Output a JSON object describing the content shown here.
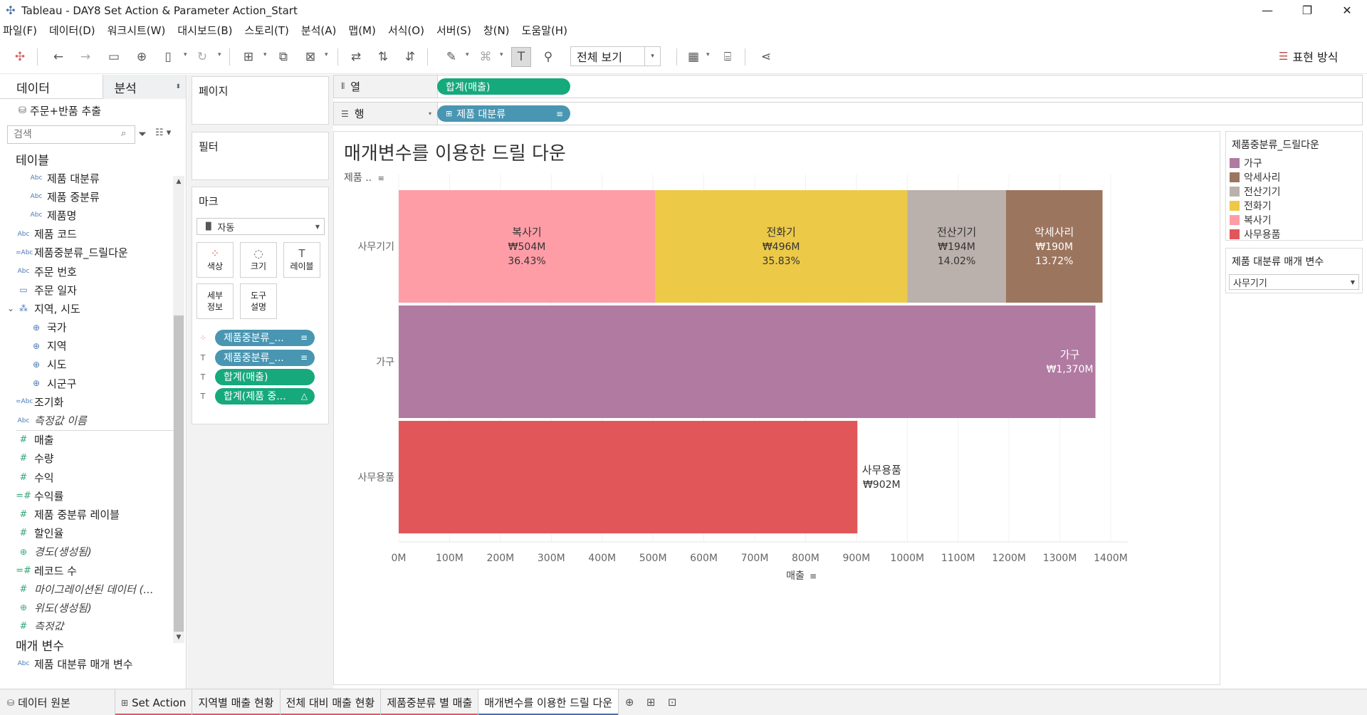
{
  "window": {
    "title": "Tableau - DAY8 Set Action & Parameter Action_Start"
  },
  "menu": [
    "파일(F)",
    "데이터(D)",
    "워크시트(W)",
    "대시보드(B)",
    "스토리(T)",
    "분석(A)",
    "맵(M)",
    "서식(O)",
    "서버(S)",
    "창(N)",
    "도움말(H)"
  ],
  "toolbar": {
    "view_mode": "전체 보기",
    "show_me": "표현 방식"
  },
  "data_pane": {
    "tab_data": "데이터",
    "tab_analysis": "분석",
    "datasource": "주문+반품 추출",
    "search_placeholder": "검색",
    "tables_title": "테이블",
    "fields": [
      {
        "type": "Abc",
        "name": "제품 대분류",
        "level": 1,
        "italic": false
      },
      {
        "type": "Abc",
        "name": "제품 중분류",
        "level": 1,
        "italic": false
      },
      {
        "type": "Abc",
        "name": "제품명",
        "level": 1,
        "italic": false
      },
      {
        "type": "Abc",
        "name": "제품 코드",
        "level": 0,
        "italic": false
      },
      {
        "type": "=Abc",
        "name": "제품중분류_드릴다운",
        "level": 0,
        "italic": false
      },
      {
        "type": "Abc",
        "name": "주문 번호",
        "level": 0,
        "italic": false
      },
      {
        "type": "date",
        "name": "주문 일자",
        "level": 0,
        "italic": false
      },
      {
        "type": "hier",
        "name": "지역, 시도",
        "level": 0,
        "italic": false
      },
      {
        "type": "geo",
        "name": "국가",
        "level": 1,
        "italic": false
      },
      {
        "type": "geo",
        "name": "지역",
        "level": 1,
        "italic": false
      },
      {
        "type": "geo",
        "name": "시도",
        "level": 1,
        "italic": false
      },
      {
        "type": "geo",
        "name": "시군구",
        "level": 1,
        "italic": false
      },
      {
        "type": "=Abc",
        "name": "조기화",
        "level": 0,
        "italic": false
      },
      {
        "type": "Abc",
        "name": "측정값 이름",
        "level": 0,
        "italic": true
      }
    ],
    "measures": [
      {
        "type": "#",
        "name": "매출",
        "italic": false
      },
      {
        "type": "#",
        "name": "수량",
        "italic": false
      },
      {
        "type": "#",
        "name": "수익",
        "italic": false
      },
      {
        "type": "=#",
        "name": "수익률",
        "italic": false
      },
      {
        "type": "#",
        "name": "제품 중분류 레이블",
        "italic": false
      },
      {
        "type": "#",
        "name": "할인율",
        "italic": false
      },
      {
        "type": "geo",
        "name": "경도(생성됨)",
        "italic": true
      },
      {
        "type": "=#",
        "name": "레코드 수",
        "italic": false
      },
      {
        "type": "#",
        "name": "마이그레이션된 데이터 (...",
        "italic": true
      },
      {
        "type": "geo",
        "name": "위도(생성됨)",
        "italic": true
      },
      {
        "type": "#",
        "name": "측정값",
        "italic": true
      }
    ],
    "params_title": "매개 변수",
    "params": [
      {
        "type": "Abc",
        "name": "제품 대분류 매개 변수"
      }
    ]
  },
  "shelves": {
    "pages": "페이지",
    "filters": "필터",
    "marks": "마크",
    "marks_type": "자동",
    "mark_buttons": {
      "color": "색상",
      "size": "크기",
      "label": "레이블",
      "detail_1": "세부",
      "detail_2": "정보",
      "tooltip_1": "도구",
      "tooltip_2": "설명"
    },
    "mark_pills": [
      "제품중분류_...",
      "제품중분류_...",
      "합계(매출)",
      "합계(제품 중..."
    ],
    "columns_label": "열",
    "columns_pill": "합계(매출)",
    "rows_label": "행",
    "rows_pill": "제품 대분류"
  },
  "sheet": {
    "title": "매개변수를 이용한 드릴 다운",
    "row_header": "제품 ..",
    "x_title": "매출"
  },
  "chart_data": {
    "type": "bar",
    "orientation": "horizontal",
    "stacked": true,
    "categories": [
      "사무기기",
      "가구",
      "사무용품"
    ],
    "xlabel": "매출",
    "xlim": [
      0,
      1400
    ],
    "x_ticks": [
      "0M",
      "100M",
      "200M",
      "300M",
      "400M",
      "500M",
      "600M",
      "700M",
      "800M",
      "900M",
      "1000M",
      "1100M",
      "1200M",
      "1300M",
      "1400M"
    ],
    "segments": [
      {
        "category": "사무기기",
        "name": "복사기",
        "value": 504,
        "label": "₩504M",
        "pct": "36.43%",
        "color": "#ff9da7"
      },
      {
        "category": "사무기기",
        "name": "전화기",
        "value": 496,
        "label": "₩496M",
        "pct": "35.83%",
        "color": "#edc948"
      },
      {
        "category": "사무기기",
        "name": "전산기기",
        "value": 194,
        "label": "₩194M",
        "pct": "14.02%",
        "color": "#bab0ac"
      },
      {
        "category": "사무기기",
        "name": "악세사리",
        "value": 190,
        "label": "₩190M",
        "pct": "13.72%",
        "color": "#9c755f"
      },
      {
        "category": "가구",
        "name": "가구",
        "value": 1370,
        "label": "₩1,370M",
        "pct": "",
        "color": "#b07aa1"
      },
      {
        "category": "사무용품",
        "name": "사무용품",
        "value": 902,
        "label": "₩902M",
        "pct": "",
        "color": "#e15759"
      }
    ]
  },
  "legend": {
    "title": "제품중분류_드릴다운",
    "items": [
      {
        "name": "가구",
        "color": "#b07aa1"
      },
      {
        "name": "악세사리",
        "color": "#9c755f"
      },
      {
        "name": "전산기기",
        "color": "#bab0ac"
      },
      {
        "name": "전화기",
        "color": "#edc948"
      },
      {
        "name": "복사기",
        "color": "#ff9da7"
      },
      {
        "name": "사무용품",
        "color": "#e15759"
      }
    ]
  },
  "parameter_card": {
    "title": "제품 대분류 매개 변수",
    "value": "사무기기"
  },
  "tabs": {
    "datasource": "데이터 원본",
    "sheets": [
      "Set Action",
      "지역별 매출 현황",
      "전체 대비 매출 현황",
      "제품중분류 별 매출",
      "매개변수를 이용한 드릴 다운"
    ],
    "active": 4
  }
}
